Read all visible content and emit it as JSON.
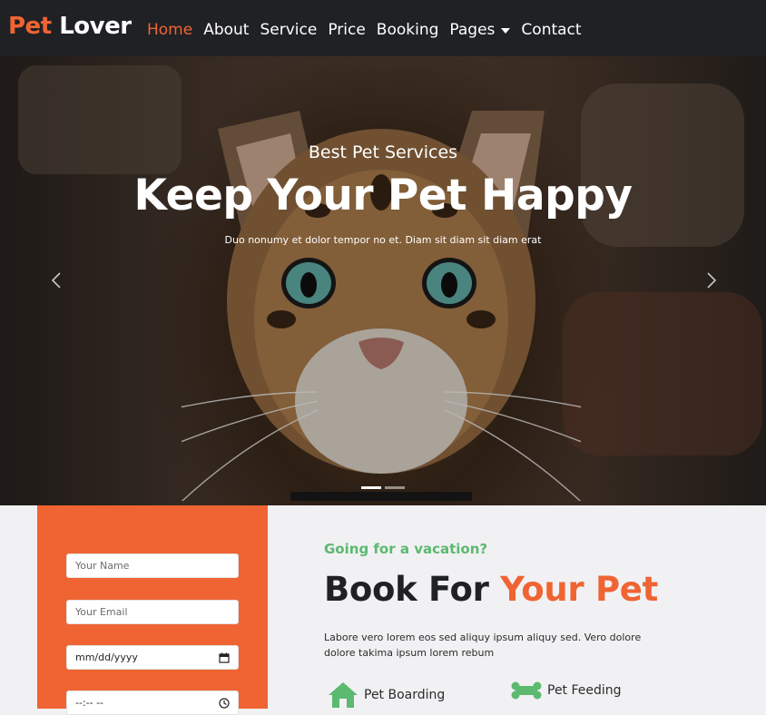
{
  "navbar": {
    "brand_part1": "Pet",
    "brand_part2": "Lover",
    "items": [
      {
        "label": "Home",
        "active": true
      },
      {
        "label": "About"
      },
      {
        "label": "Service"
      },
      {
        "label": "Price"
      },
      {
        "label": "Booking"
      },
      {
        "label": "Pages",
        "dropdown": true
      },
      {
        "label": "Contact"
      }
    ]
  },
  "hero": {
    "subtitle": "Best Pet Services",
    "title": "Keep Your Pet Happy",
    "description": "Duo nonumy et dolor tempor no et. Diam sit diam sit diam erat",
    "slides": 2,
    "active_slide": 1,
    "prev_icon": "chevron-left-icon",
    "next_icon": "chevron-right-icon"
  },
  "booking_form": {
    "name_placeholder": "Your Name",
    "email_placeholder": "Your Email",
    "date_placeholder": "mm/dd/yyyy",
    "time_placeholder": "--:-- --",
    "date_icon": "calendar-icon",
    "time_icon": "clock-icon"
  },
  "book_section": {
    "eyebrow": "Going for a vacation?",
    "title_part1": "Book For",
    "title_part2": "Your Pet",
    "text": "Labore vero lorem eos sed aliquy ipsum aliquy sed. Vero dolore dolore takima ipsum lorem rebum",
    "features": [
      {
        "label": "Pet Boarding",
        "icon": "house-icon"
      },
      {
        "label": "Pet Feeding",
        "icon": "bone-icon"
      }
    ]
  },
  "colors": {
    "primary": "#ef6432",
    "secondary": "#5cb970",
    "dark": "#1f2125",
    "background": "#f1f1f3"
  }
}
